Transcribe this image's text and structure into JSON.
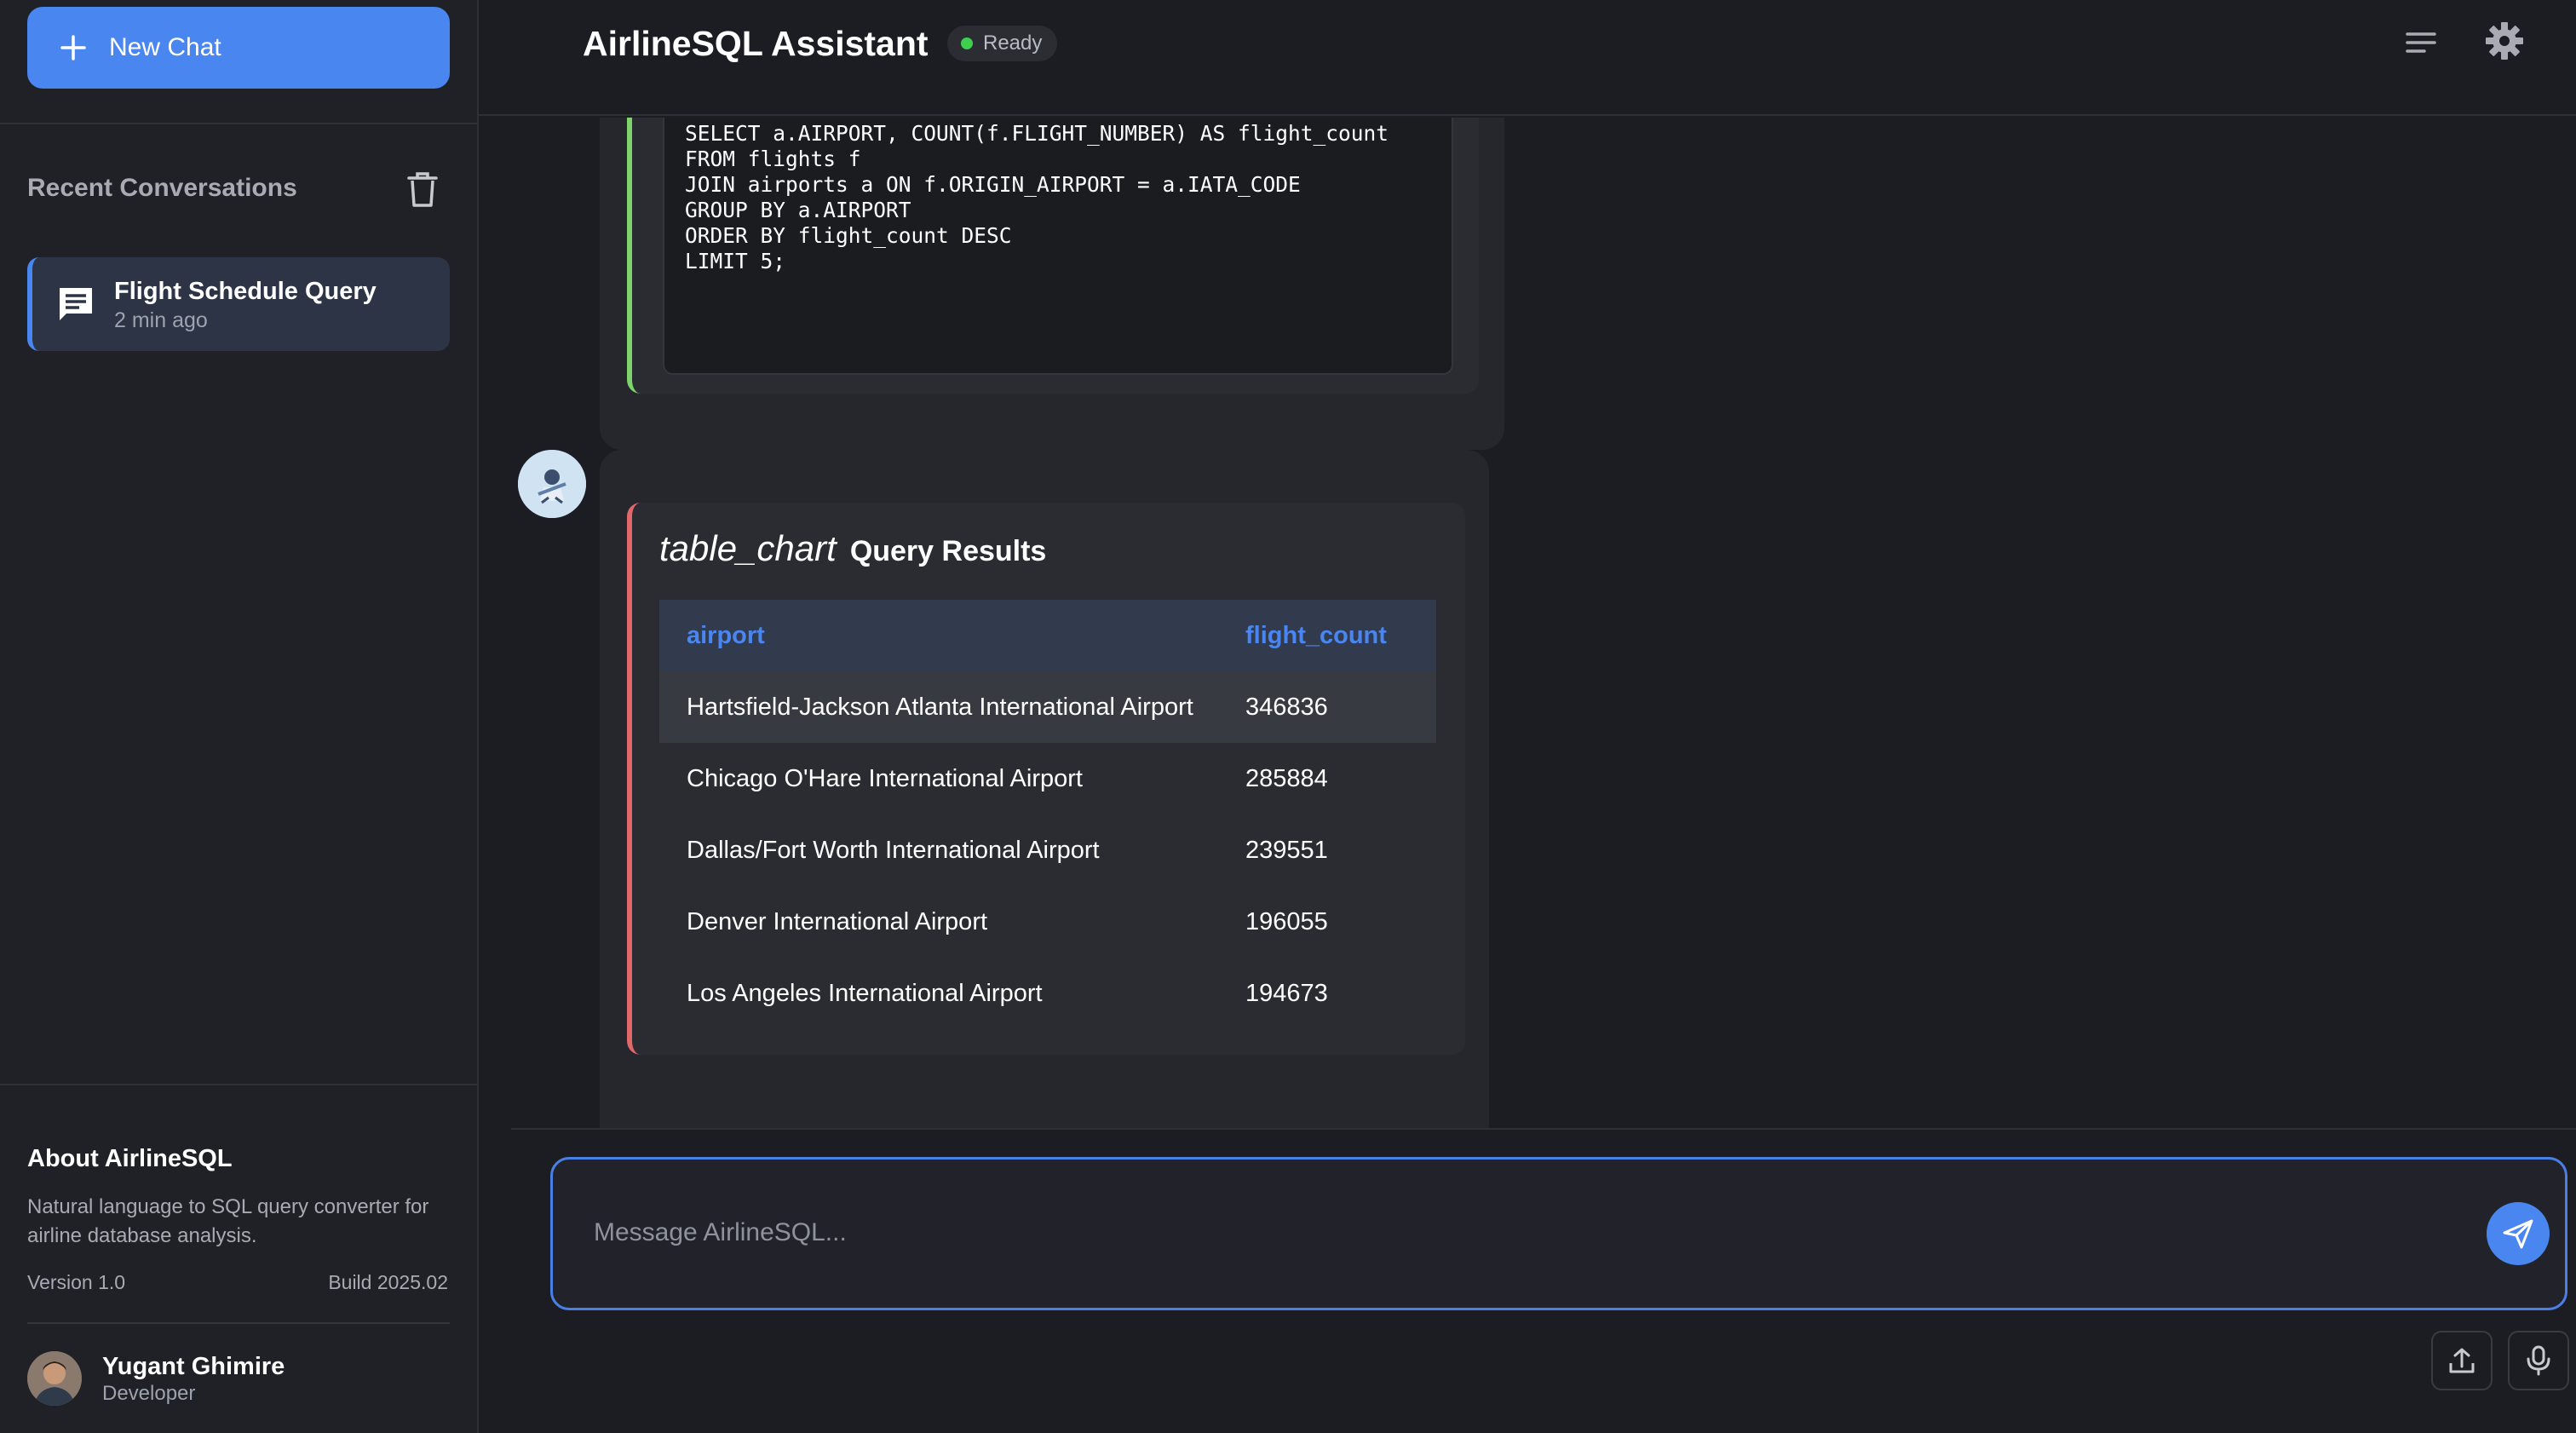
{
  "sidebar": {
    "new_chat_label": "New Chat",
    "recent_title": "Recent Conversations",
    "conversations": [
      {
        "title": "Flight Schedule Query",
        "time": "2 min ago"
      }
    ],
    "about": {
      "title": "About AirlineSQL",
      "description": "Natural language to SQL query converter for airline database analysis.",
      "version": "Version 1.0",
      "build": "Build 2025.02"
    },
    "user": {
      "name": "Yugant Ghimire",
      "role": "Developer"
    }
  },
  "header": {
    "title": "AirlineSQL Assistant",
    "status": "Ready",
    "status_color": "#3ecf4f"
  },
  "messages": {
    "sql_code": "SELECT a.AIRPORT, COUNT(f.FLIGHT_NUMBER) AS flight_count\nFROM flights f\nJOIN airports a ON f.ORIGIN_AIRPORT = a.IATA_CODE\nGROUP BY a.AIRPORT\nORDER BY flight_count DESC\nLIMIT 5;",
    "results": {
      "icon_text": "table_chart",
      "title": "Query Results",
      "columns": [
        "airport",
        "flight_count"
      ],
      "rows": [
        [
          "Hartsfield-Jackson Atlanta International Airport",
          "346836"
        ],
        [
          "Chicago O'Hare International Airport",
          "285884"
        ],
        [
          "Dallas/Fort Worth International Airport",
          "239551"
        ],
        [
          "Denver International Airport",
          "196055"
        ],
        [
          "Los Angeles International Airport",
          "194673"
        ]
      ]
    }
  },
  "composer": {
    "placeholder": "Message AirlineSQL..."
  },
  "colors": {
    "accent": "#4a86f0",
    "sql_border": "#7ed36a",
    "results_border": "#e0676a"
  },
  "icons": {
    "new_chat": "plus-icon",
    "clear": "trash-icon",
    "conversation": "chat-icon",
    "menu": "menu-icon",
    "settings": "gear-icon",
    "send": "send-icon",
    "upload": "upload-icon",
    "mic": "mic-icon"
  }
}
